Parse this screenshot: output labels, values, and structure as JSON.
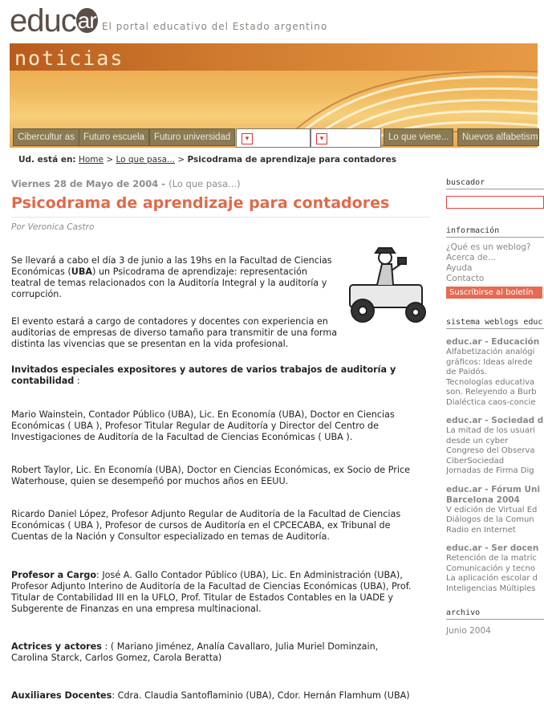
{
  "header": {
    "logo_main": "educ",
    "logo_suffix": "ar",
    "tagline": "El portal educativo del Estado argentino"
  },
  "banner": {
    "title": "noticias",
    "tabs": [
      "Cibercultur as",
      "Futuro escuela",
      "Futuro universidad",
      "Lo que viene...",
      "Nuevos alfabetismo"
    ]
  },
  "breadcrumb": {
    "prefix": "Ud. está en:",
    "home": "Home",
    "section": "Lo que pasa...",
    "current": "Psicodrama de aprendizaje para contadores"
  },
  "article": {
    "date": "Viernes 28 de Mayo de 2004 -",
    "date_link": "(Lo que pasa...)",
    "title": "Psicodrama de aprendizaje para contadores",
    "author": "Por Veronica Castro",
    "p1_a": "Se llevará a cabo el día 3 de junio a las 19hs en la Facultad de Ciencias Económicas (",
    "p1_b": "UBA",
    "p1_c": ") un Psicodrama de aprendizaje: representación teatral de temas relacionados con la Auditoría Integral y la auditoría y corrupción.",
    "p2": "El evento estará a cargo de contadores y docentes con experiencia en auditorias de empresas de diverso tamaño para transmitir de una forma distinta las vivencias que se presentan en la vida profesional.",
    "p3_b": "Invitados especiales expositores y autores de varios trabajos de auditoría y contabilidad",
    "p3_c": " :",
    "p4": "Mario Wainstein, Contador Público (UBA), Lic. En Economía (UBA), Doctor en Ciencias Económicas ( UBA ), Profesor Titular Regular de Auditoría y Director del Centro de Investigaciones de Auditoría de la Facultad de Ciencias Económicas ( UBA ).",
    "p5": "Robert Taylor, Lic. En Economía (UBA), Doctor en Ciencias Económicas, ex Socio de Price Waterhouse, quien se desempeñó por muchos años en EEUU.",
    "p6": "Ricardo Daniel López, Profesor Adjunto Regular de Auditoría de la Facultad de Ciencias Económicas ( UBA ), Profesor de cursos de Auditoría en el CPCECABA, ex Tribunal de Cuentas de la Nación y Consultor especializado en temas de Auditoría.",
    "p7_b": "Profesor a Cargo",
    "p7_c": ": José A. Gallo Contador Público (UBA), Lic. En Administración (UBA), Profesor Adjunto Interino de Auditoría de la Facultad de Ciencias Económicas (UBA), Prof. Titular de Contabilidad III en la UFLO, Prof. Titular de Estados Contables en la UADE y Subgerente de Finanzas en una empresa multinacional.",
    "p8_b": "Actrices y actores",
    "p8_c": " : ( Mariano Jiménez, Analía Cavallaro, Julia Muriel Dominzain, Carolina Starck, Carlos Gomez, Carola Beratta)",
    "p9_b": "Auxiliares Docentes",
    "p9_c": ": Cdra. Claudia Santoflaminio (UBA), Cdor. Hernán Flamhum (UBA)"
  },
  "sidebar": {
    "buscador": "buscador",
    "informacion": "información",
    "info_links": [
      "¿Qué es un weblog?",
      "Acerca de...",
      "Ayuda",
      "Contacto"
    ],
    "subscribe": "Suscribirse al boletín",
    "sistema": "sistema weblogs educ",
    "blogs": [
      {
        "title": "educ.ar - Educación",
        "items": [
          "Alfabetización analógi",
          "gráficos: Ideas alrede",
          "de Paidós.",
          "Tecnologías educativa",
          "son. Releyendo a Burb",
          "Dialéctica caos-concie"
        ]
      },
      {
        "title": "educ.ar - Sociedad d",
        "items": [
          "La mitad de los usuari",
          "desde un cyber",
          "Congreso del Observa",
          "CiberSociedad",
          "Jornadas de Firma Dig"
        ]
      },
      {
        "title": "educ.ar - Fórum Uni",
        "title2": "Barcelona 2004",
        "items": [
          "V edición de Virtual Ed",
          "Diálogos de la Comun",
          "Radio en Internet"
        ]
      },
      {
        "title": "educ.ar - Ser docen",
        "items": [
          "Retención de la matríc",
          "Comunicación y tecno",
          "La aplicación escolar d",
          "Inteligencias Múltiples"
        ]
      }
    ],
    "archivo": "archivo",
    "archivo_item": "Junio 2004"
  }
}
